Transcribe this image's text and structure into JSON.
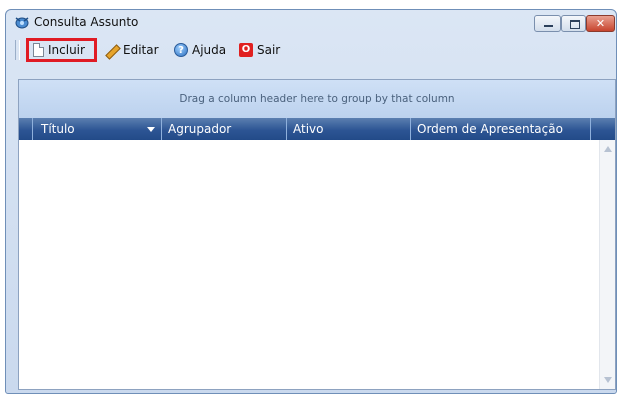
{
  "window": {
    "title": "Consulta Assunto",
    "controls": {
      "minimize": "minimize",
      "maximize": "maximize",
      "close": "✕"
    }
  },
  "toolbar": {
    "incluir_label": "Incluir",
    "editar_label": "Editar",
    "ajuda_label": "Ajuda",
    "sair_label": "Sair",
    "icons": {
      "incluir": "new-document-icon",
      "editar": "pencil-icon",
      "ajuda": "help-icon",
      "sair": "exit-icon"
    }
  },
  "grid": {
    "group_panel_text": "Drag a column header here to group by that column",
    "columns": [
      "Título",
      "Agrupador",
      "Ativo",
      "Ordem de Apresentação"
    ],
    "rows": []
  },
  "colors": {
    "highlight": "#e01b24",
    "header": "#2d5594"
  }
}
